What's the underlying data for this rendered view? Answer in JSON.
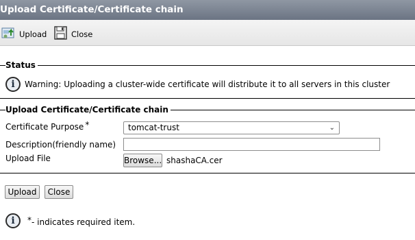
{
  "window": {
    "title": "Upload Certificate/Certificate chain"
  },
  "toolbar": {
    "upload_label": "Upload",
    "close_label": "Close"
  },
  "status": {
    "legend": "Status",
    "message": "Warning: Uploading a cluster-wide certificate will distribute it to all servers in this cluster"
  },
  "form": {
    "legend": "Upload Certificate/Certificate chain",
    "purpose_label": "Certificate Purpose",
    "required_mark": "*",
    "purpose_value": "tomcat-trust",
    "description_label": "Description(friendly name)",
    "description_value": "",
    "upload_file_label": "Upload File",
    "browse_label": "Browse...",
    "file_name": "shashaCA.cer"
  },
  "buttons": {
    "upload_label": "Upload",
    "close_label": "Close"
  },
  "footer": {
    "required_mark": "*",
    "note": "- indicates required item."
  },
  "icons": [
    "upload-icon",
    "close-icon",
    "info-icon",
    "chevron-down-icon"
  ]
}
